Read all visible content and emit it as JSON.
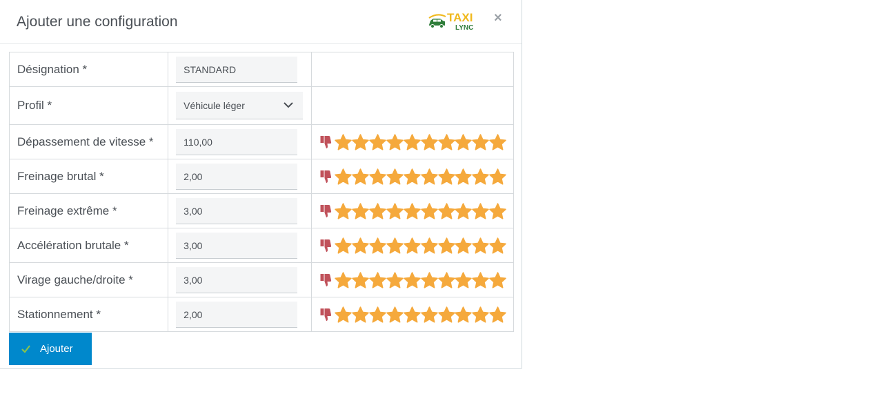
{
  "modal": {
    "title": "Ajouter une configuration",
    "logo_top": "TAXI",
    "logo_bottom": "LYNC",
    "close_glyph": "×"
  },
  "form": {
    "designation": {
      "label": "Désignation *",
      "value": "STANDARD"
    },
    "profil": {
      "label": "Profil *",
      "value": "Véhicule léger"
    },
    "rows": [
      {
        "label": "Dépassement de vitesse *",
        "value": "110,00",
        "stars": 10
      },
      {
        "label": "Freinage brutal *",
        "value": "2,00",
        "stars": 10
      },
      {
        "label": "Freinage extrême *",
        "value": "3,00",
        "stars": 10
      },
      {
        "label": "Accélération brutale *",
        "value": "3,00",
        "stars": 10
      },
      {
        "label": "Virage gauche/droite *",
        "value": "3,00",
        "stars": 10
      },
      {
        "label": "Stationnement *",
        "value": "2,00",
        "stars": 10
      }
    ]
  },
  "submit": {
    "label": "Ajouter"
  },
  "colors": {
    "primary": "#0088cc",
    "star": "#f5a93c",
    "thumb": "#c0515a",
    "check": "#8bc34a"
  }
}
